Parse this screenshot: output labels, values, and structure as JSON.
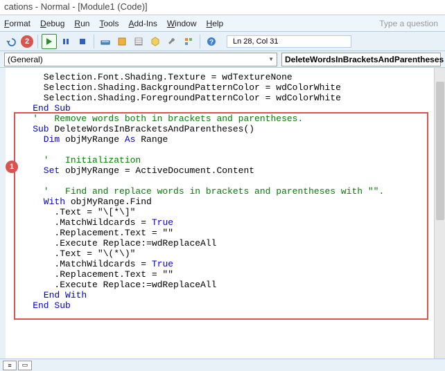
{
  "title": "cations - Normal - [Module1 (Code)]",
  "menu": {
    "format": "Format",
    "debug": "Debug",
    "run": "Run",
    "tools": "Tools",
    "addins": "Add-Ins",
    "window": "Window",
    "help": "Help"
  },
  "search_placeholder": "Type a question",
  "status": "Ln 28, Col 31",
  "dropdowns": {
    "left": "(General)",
    "right": "DeleteWordsInBracketsAndParentheses"
  },
  "callouts": {
    "one": "1",
    "two": "2"
  },
  "code": {
    "l1": "      Selection.Font.Shading.Texture = wdTextureNone",
    "l2": "      Selection.Shading.BackgroundPatternColor = wdColorWhite",
    "l3": "      Selection.Shading.ForegroundPatternColor = wdColorWhite",
    "l4a": "    End Sub",
    "l5a": "    '   Remove words both in brackets and parentheses.",
    "l6a": "    Sub",
    "l6b": " DeleteWordsInBracketsAndParentheses()",
    "l7a": "      Dim",
    "l7b": " objMyRange ",
    "l7c": "As",
    "l7d": " Range",
    "l8": "",
    "l9": "      '   Initialization",
    "l10a": "      Set",
    "l10b": " objMyRange = ActiveDocument.Content",
    "l11": "",
    "l12": "      '   Find and replace words in brackets and parentheses with \"\".",
    "l13a": "      With",
    "l13b": " objMyRange.Find",
    "l14": "        .Text = \"\\[*\\]\"",
    "l15a": "        .MatchWildcards = ",
    "l15b": "True",
    "l16": "        .Replacement.Text = \"\"",
    "l17": "        .Execute Replace:=wdReplaceAll",
    "l18": "        .Text = \"\\(*\\)\"",
    "l19a": "        .MatchWildcards = ",
    "l19b": "True",
    "l20": "        .Replacement.Text = \"\"",
    "l21": "        .Execute Replace:=wdReplaceAll",
    "l22": "      End With",
    "l23": "    End Sub"
  }
}
